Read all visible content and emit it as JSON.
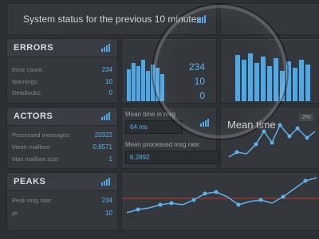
{
  "header": {
    "title": "System status for the previous 10 minutes"
  },
  "errors": {
    "title": "ERRORS",
    "rows": [
      {
        "label": "Error count:",
        "value": "234"
      },
      {
        "label": "Warnings:",
        "value": "10"
      },
      {
        "label": "Deadlocks:",
        "value": "0"
      }
    ],
    "magnified": [
      "234",
      "10",
      "0"
    ]
  },
  "actors": {
    "title": "ACTORS",
    "rows": [
      {
        "label": "Processed messages:",
        "value": "20322"
      },
      {
        "label": "Mean mailbox:",
        "value": "0.8571"
      },
      {
        "label": "Max mailbox size:",
        "value": "1"
      }
    ],
    "mean_time_label": "Mean time in msg",
    "mean_time_value": "64 ms",
    "mean_processed_label": "Mean processed msg rate:",
    "mean_processed_value": "6.2892",
    "chart_title": "Mean time",
    "badge": "2%"
  },
  "peaks": {
    "title": "PEAKS",
    "rows": [
      {
        "label": "Peak msg rate:",
        "value": "234"
      },
      {
        "label": "pt:",
        "value": "10"
      }
    ]
  },
  "colors": {
    "accent": "#5fb3ea",
    "threshold": "#c0392b",
    "panel": "#34383d",
    "background": "#2c2f33"
  }
}
